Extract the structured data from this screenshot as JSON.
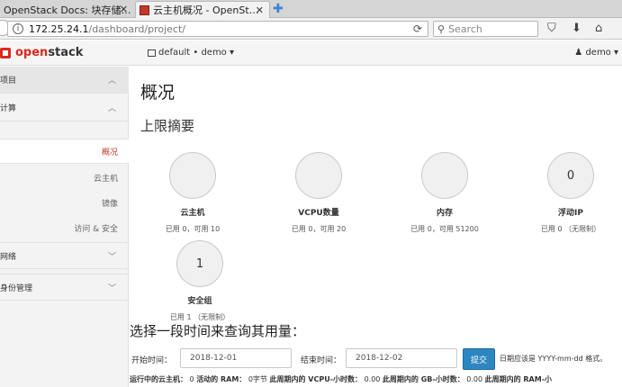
{
  "browser": {
    "tabs": [
      {
        "label": "OpenStack Docs: 块存储…",
        "active": false
      },
      {
        "label": "云主机概况 - OpenSt…",
        "active": true
      }
    ],
    "tab_close": "✕",
    "new_tab": "✚",
    "url_host": "172.25.24.1",
    "url_path": "/dashboard/project/",
    "search_placeholder": "Search"
  },
  "header": {
    "brand_open": "open",
    "brand_stack": "stack",
    "project_selector": "default • demo ▾",
    "user_menu": "♟ demo ▾"
  },
  "sidebar": {
    "project": "项目",
    "compute": "计算",
    "overview": "概况",
    "instances": "云主机",
    "images": "镜像",
    "access_security": "访问 & 安全",
    "network": "网络",
    "identity": "身份管理"
  },
  "main": {
    "title": "概况",
    "limits_title": "上限摘要",
    "limits": [
      {
        "label": "云主机",
        "note": "已用 0，可用 10",
        "value": ""
      },
      {
        "label": "VCPU数量",
        "note": "已用 0，可用 20",
        "value": ""
      },
      {
        "label": "内存",
        "note": "已用 0，可用 51200",
        "value": ""
      },
      {
        "label": "浮动IP",
        "note": "已用 0 （无限制）",
        "value": "0"
      },
      {
        "label": "安全组",
        "note": "已用 1 （无限制）",
        "value": "1"
      }
    ],
    "usage_title": "选择一段时间来查询其用量：",
    "start_label": "开始时间：",
    "start_value": "2018-12-01",
    "end_label": "结束时间：",
    "end_value": "2018-12-02",
    "submit_label": "提交",
    "date_hint": "日期应该是 YYYY-mm-dd 格式。",
    "summary": {
      "active_instances_label": "运行中的云主机：",
      "active_instances": "0",
      "ram_label": "活动的 RAM：",
      "ram": "0字节",
      "vcpu_hours_label": "此周期内的 VCPU-小时数：",
      "vcpu_hours": "0.00",
      "gb_hours_label": "此周期内的 GB-小时数：",
      "gb_hours": "0.00",
      "ram_hours_label": "此周期内的 RAM-小"
    }
  }
}
